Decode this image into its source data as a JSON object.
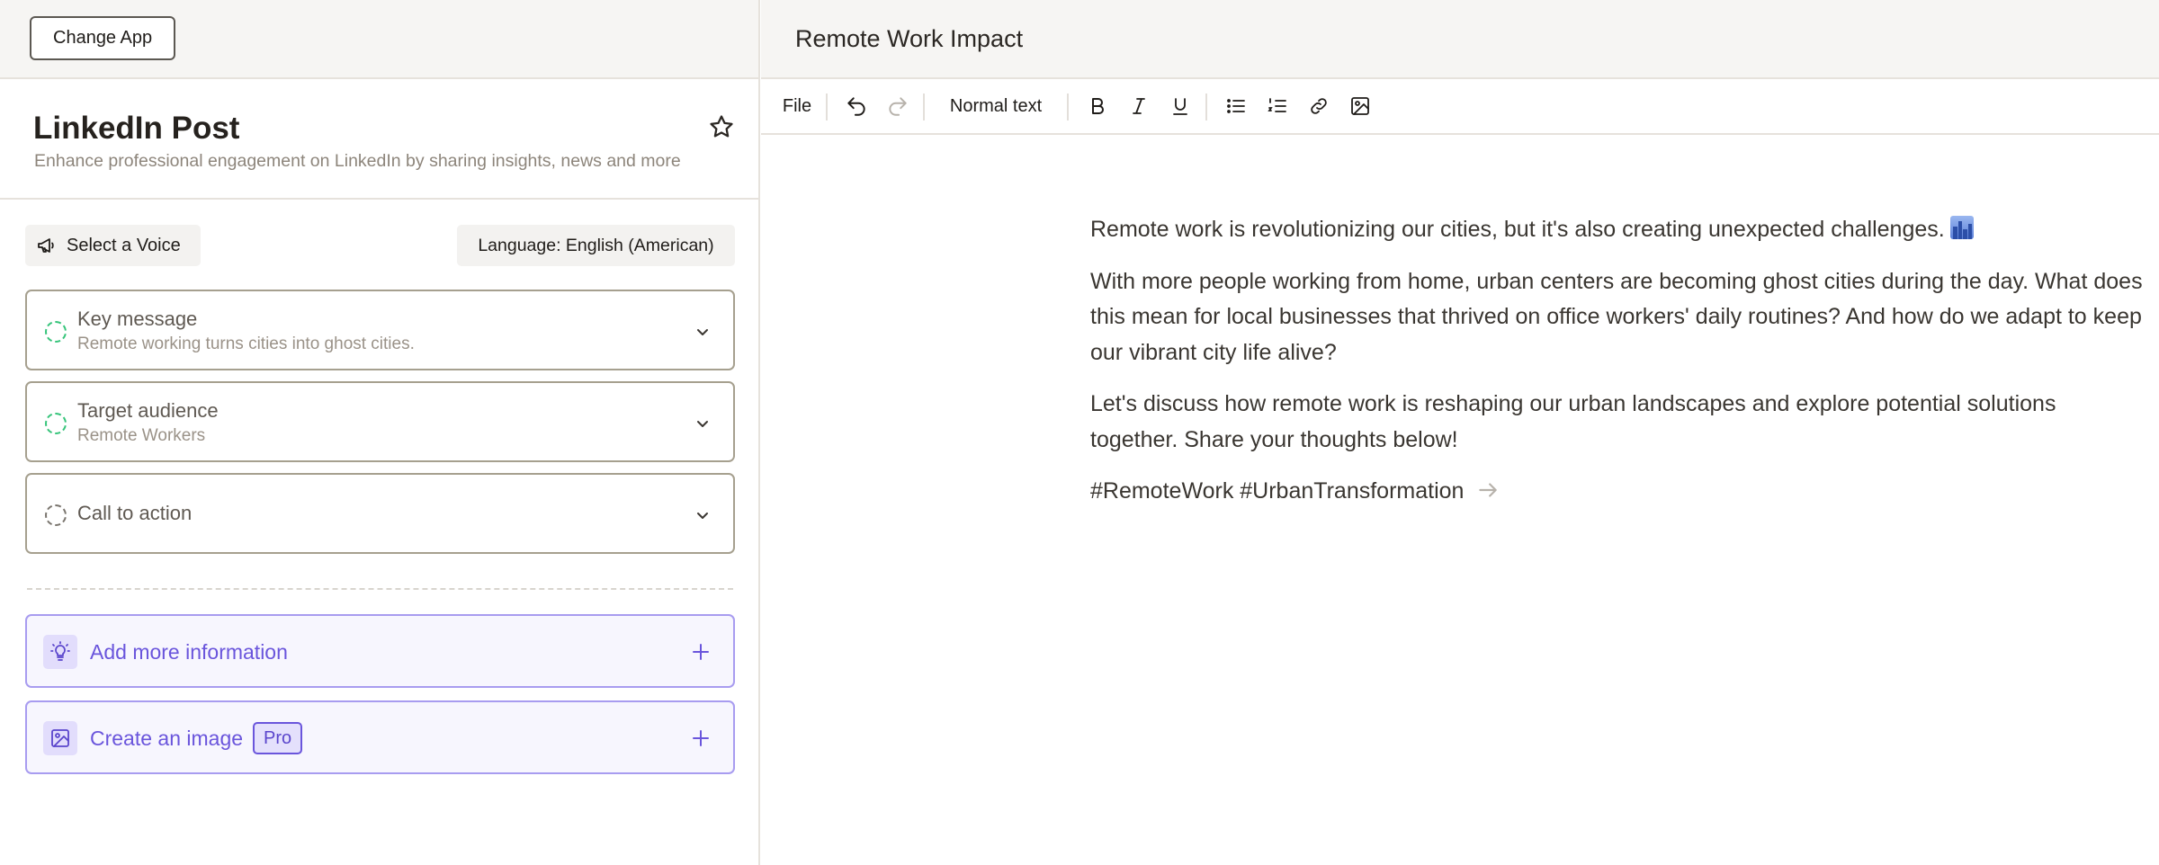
{
  "left": {
    "change_app_label": "Change App",
    "app_title": "LinkedIn Post",
    "app_subtitle": "Enhance professional engagement on LinkedIn by sharing insights, news and more",
    "voice_label": "Select a Voice",
    "language_label": "Language: English (American)",
    "fields": [
      {
        "label": "Key message",
        "value": "Remote working turns cities into ghost cities."
      },
      {
        "label": "Target audience",
        "value": "Remote Workers"
      },
      {
        "label": "Call to action",
        "value": ""
      }
    ],
    "extras": [
      {
        "label": "Add more information"
      },
      {
        "label": "Create an image",
        "badge": "Pro"
      }
    ]
  },
  "right": {
    "doc_title": "Remote Work Impact",
    "toolbar": {
      "file_label": "File",
      "style_label": "Normal text"
    },
    "paragraphs": [
      "Remote work is revolutionizing our cities, but it's also creating unexpected challenges.",
      "With more people working from home, urban centers are becoming ghost cities during the day. What does this mean for local businesses that thrived on office workers' daily routines? And how do we adapt to keep our vibrant city life alive?",
      "Let's discuss how remote work is reshaping our urban landscapes and explore potential solutions together. Share your thoughts below!",
      "#RemoteWork #UrbanTransformation"
    ]
  },
  "colors": {
    "accent": "#6a55dc",
    "success": "#36c47a",
    "border": "#a6a08f",
    "panel_bg": "#f6f5f3"
  },
  "icons": [
    "megaphone-icon",
    "star-icon",
    "chevron-down-icon",
    "lightbulb-icon",
    "image-icon",
    "plus-icon",
    "undo-icon",
    "redo-icon",
    "bold-icon",
    "italic-icon",
    "underline-icon",
    "bullet-list-icon",
    "numbered-list-icon",
    "link-icon",
    "insert-image-icon",
    "arrow-right-icon",
    "cityscape-emoji-icon"
  ]
}
